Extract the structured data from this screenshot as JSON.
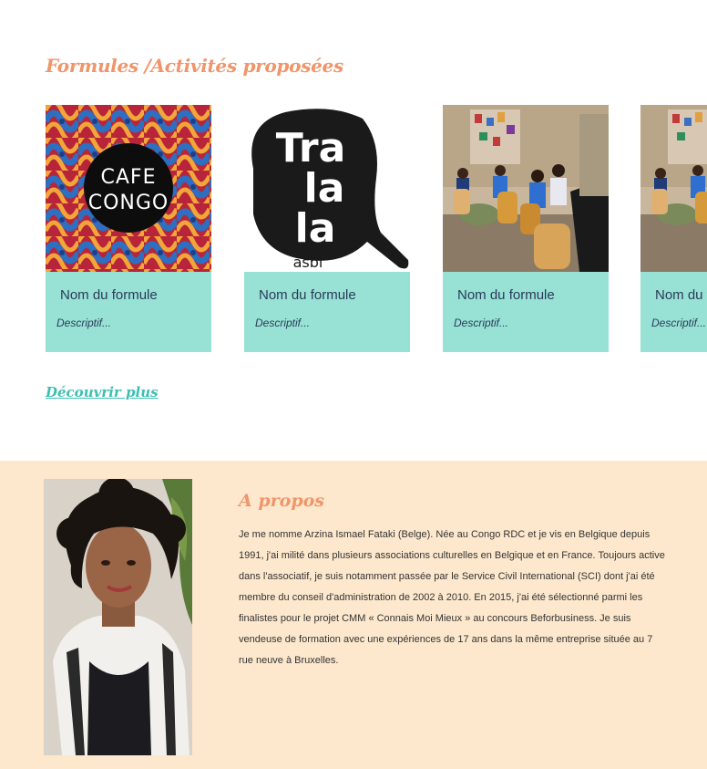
{
  "activities": {
    "title": "Formules /Activités proposées",
    "cards": [
      {
        "name": "Nom du formule",
        "description": "Descriptif...",
        "image": "cafe-congo-logo"
      },
      {
        "name": "Nom du formule",
        "description": "Descriptif...",
        "image": "tralala-asbl-logo"
      },
      {
        "name": "Nom du formule",
        "description": "Descriptif...",
        "image": "drum-circle-photo"
      },
      {
        "name": "Nom du formule",
        "description": "Descriptif...",
        "image": "drum-circle-photo"
      }
    ],
    "more_label": "Découvrir plus"
  },
  "logos": {
    "cafe_congo_line1": "CAFE",
    "cafe_congo_line2": "CONGO",
    "tralala_line1": "Tra",
    "tralala_line2": "la",
    "tralala_line3": "la",
    "tralala_sub": "asbl"
  },
  "about": {
    "title": "A propos",
    "text": "Je me nomme Arzina Ismael Fataki (Belge). Née au Congo RDC et je vis en Belgique depuis 1991, j'ai milité dans plusieurs associations culturelles en Belgique et en France. Toujours active dans l'associatif, je suis notamment passée par le Service Civil International (SCI) dont j'ai été membre du conseil d'administration de 2002 à 2010. En 2015, j'ai été sélectionné parmi les finalistes pour le projet CMM « Connais Moi Mieux » au concours Beforbusiness. Je suis vendeuse de formation avec une expériences de 17 ans dans la même entreprise située au 7 rue neuve à Bruxelles."
  },
  "colors": {
    "heading": "#f0956a",
    "card_body": "#97e2d4",
    "link": "#3cbfb2",
    "about_bg": "#fde8cd"
  }
}
